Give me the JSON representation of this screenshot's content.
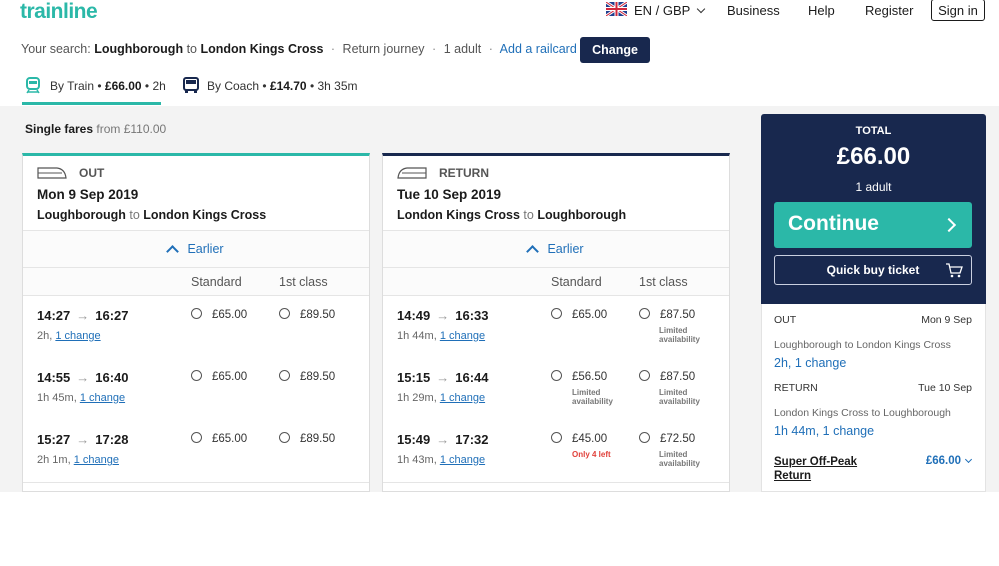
{
  "header": {
    "logo": "trainline",
    "locale": "EN / GBP",
    "nav": [
      "Business",
      "Help",
      "Register"
    ],
    "signin": "Sign in"
  },
  "search": {
    "prefix": "Your search:",
    "origin": "Loughborough",
    "to": "to",
    "destination": "London Kings Cross",
    "journey_type": "Return journey",
    "passengers": "1 adult",
    "railcard_link": "Add a railcard",
    "change_button": "Change"
  },
  "modes": [
    {
      "label": "By Train",
      "price": "£66.00",
      "duration": "2h"
    },
    {
      "label": "By Coach",
      "price": "£14.70",
      "duration": "3h 35m"
    }
  ],
  "single_fares": {
    "label": "Single fares",
    "from": "from £110.00"
  },
  "outbound": {
    "direction": "OUT",
    "date": "Mon 9 Sep 2019",
    "origin": "Loughborough",
    "to": "to",
    "destination": "London Kings Cross",
    "earlier": "Earlier",
    "col_standard": "Standard",
    "col_first": "1st class",
    "rows": [
      {
        "depart": "14:27",
        "arrive": "16:27",
        "duration": "2h,",
        "changes": "1 change",
        "standard": "£65.00",
        "first": "£89.50"
      },
      {
        "depart": "14:55",
        "arrive": "16:40",
        "duration": "1h 45m,",
        "changes": "1 change",
        "standard": "£65.00",
        "first": "£89.50"
      },
      {
        "depart": "15:27",
        "arrive": "17:28",
        "duration": "2h 1m,",
        "changes": "1 change",
        "standard": "£65.00",
        "first": "£89.50"
      }
    ]
  },
  "return": {
    "direction": "RETURN",
    "date": "Tue 10 Sep 2019",
    "origin": "London Kings Cross",
    "to": "to",
    "destination": "Loughborough",
    "earlier": "Earlier",
    "col_standard": "Standard",
    "col_first": "1st class",
    "rows": [
      {
        "depart": "14:49",
        "arrive": "16:33",
        "duration": "1h 44m,",
        "changes": "1 change",
        "standard": "£65.00",
        "standard_note": "",
        "first": "£87.50",
        "first_note_1": "Limited",
        "first_note_2": "availability"
      },
      {
        "depart": "15:15",
        "arrive": "16:44",
        "duration": "1h 29m,",
        "changes": "1 change",
        "standard": "£56.50",
        "standard_note_1": "Limited",
        "standard_note_2": "availability",
        "first": "£87.50",
        "first_note_1": "Limited",
        "first_note_2": "availability"
      },
      {
        "depart": "15:49",
        "arrive": "17:32",
        "duration": "1h 43m,",
        "changes": "1 change",
        "standard": "£45.00",
        "standard_note_1": "Only 4 left",
        "first": "£72.50",
        "first_note_1": "Limited",
        "first_note_2": "availability"
      }
    ]
  },
  "summary": {
    "total_label": "TOTAL",
    "total": "£66.00",
    "passengers": "1 adult",
    "continue": "Continue",
    "quick_buy": "Quick buy ticket",
    "out_label": "OUT",
    "out_date": "Mon 9 Sep",
    "out_route": "Loughborough to London Kings Cross",
    "out_details": "2h, 1 change",
    "ret_label": "RETURN",
    "ret_date": "Tue 10 Sep",
    "ret_route": "London Kings Cross to Loughborough",
    "ret_details": "1h 44m, 1 change",
    "fare_name_1": "Super Off-Peak",
    "fare_name_2": "Return",
    "fare_price": "£66.00"
  },
  "colors": {
    "brand": "#2bb8a8",
    "navy": "#18284e",
    "link": "#1f6fb8",
    "alert": "#e0413b"
  },
  "icons": [
    "train-icon",
    "coach-icon",
    "uk-flag-icon",
    "chevron-down-icon",
    "chevron-up-icon",
    "chevron-right-icon",
    "cart-icon",
    "arrow-right-icon"
  ]
}
